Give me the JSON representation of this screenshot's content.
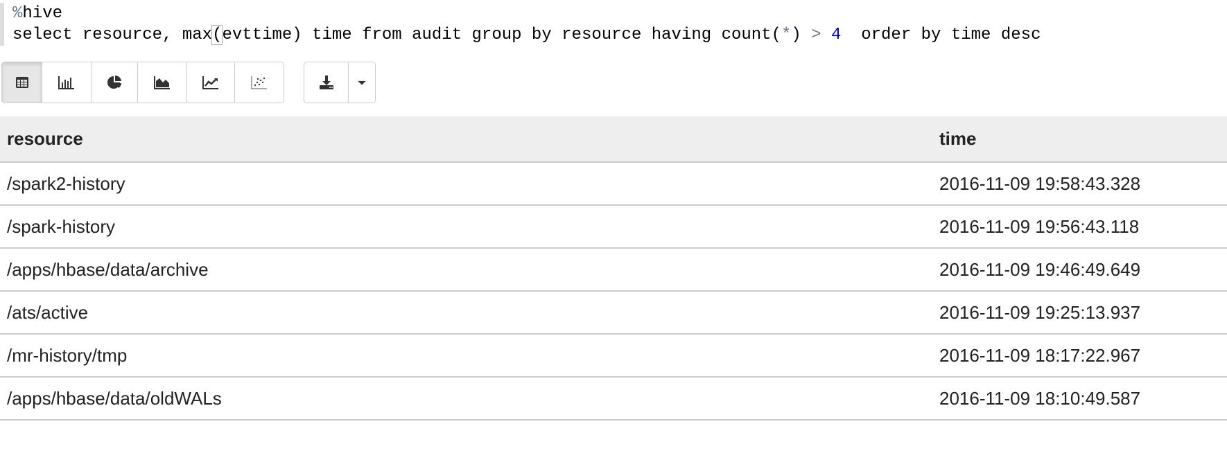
{
  "editor": {
    "interpreter": "%hive",
    "query_part1": "select resource, max",
    "query_bracket": "(",
    "query_part2": "evttime) time from audit group by resource having count(",
    "query_star": "*",
    "query_part3": ") ",
    "query_op": ">",
    "query_space": " ",
    "query_num": "4",
    "query_part4": "  order by time desc"
  },
  "toolbar": {
    "buttons": [
      "table-icon",
      "bar-chart-icon",
      "pie-chart-icon",
      "area-chart-icon",
      "line-chart-icon",
      "scatter-chart-icon"
    ],
    "active": "table-icon",
    "download": "download-icon",
    "dropdown": "caret-down-icon"
  },
  "table": {
    "columns": [
      "resource",
      "time"
    ],
    "rows": [
      [
        "/spark2-history",
        "2016-11-09 19:58:43.328"
      ],
      [
        "/spark-history",
        "2016-11-09 19:56:43.118"
      ],
      [
        "/apps/hbase/data/archive",
        "2016-11-09 19:46:49.649"
      ],
      [
        "/ats/active",
        "2016-11-09 19:25:13.937"
      ],
      [
        "/mr-history/tmp",
        "2016-11-09 18:17:22.967"
      ],
      [
        "/apps/hbase/data/oldWALs",
        "2016-11-09 18:10:49.587"
      ]
    ]
  }
}
